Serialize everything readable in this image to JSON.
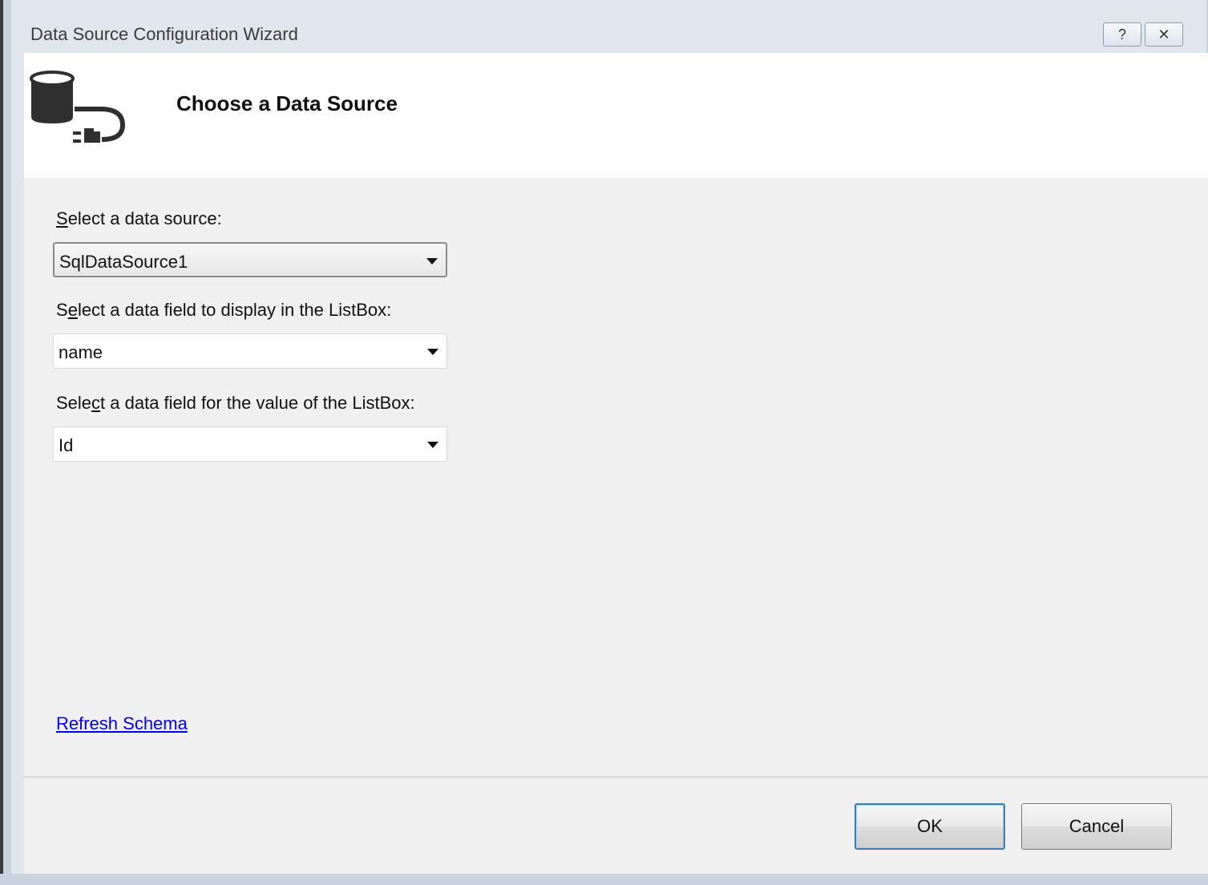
{
  "window": {
    "title": "Data Source Configuration Wizard",
    "help_glyph": "?",
    "close_glyph": "✕"
  },
  "header": {
    "title": "Choose a Data Source"
  },
  "form": {
    "data_source": {
      "label_pre": "",
      "label_access": "S",
      "label_post": "elect a data source:",
      "value": "SqlDataSource1"
    },
    "display_field": {
      "label_pre": "S",
      "label_access": "e",
      "label_post": "lect a data field to display in the ListBox:",
      "value": "name"
    },
    "value_field": {
      "label_pre": "Sele",
      "label_access": "c",
      "label_post": "t a data field for the value of the ListBox:",
      "value": "Id"
    },
    "refresh_link": "Refresh Schema"
  },
  "buttons": {
    "ok": "OK",
    "cancel": "Cancel"
  }
}
